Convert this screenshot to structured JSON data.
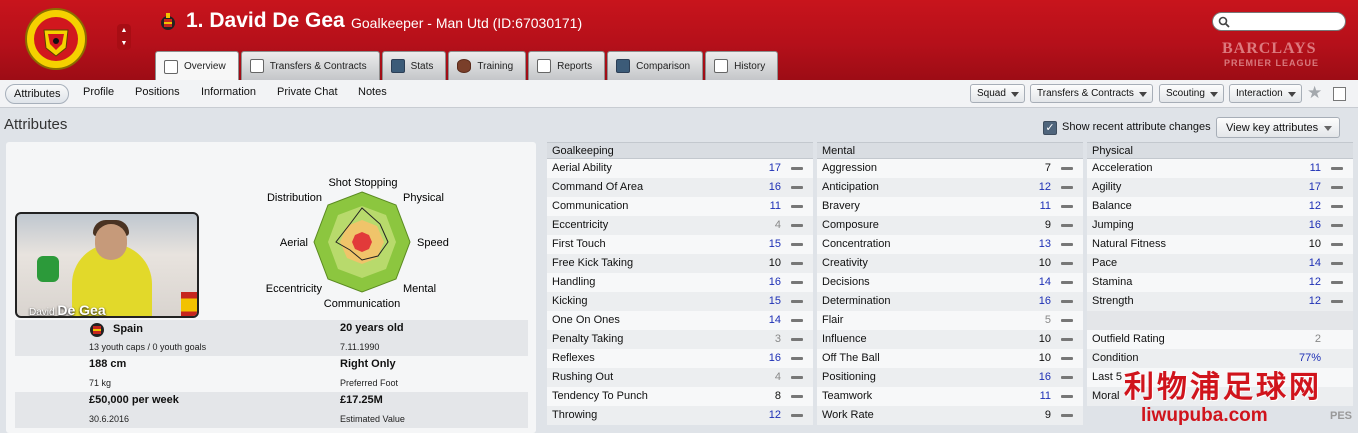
{
  "header": {
    "club_crest": "manchester-united-crest",
    "title": "1. David De Gea",
    "subtitle": "Goalkeeper - Man Utd (ID:67030171)",
    "sponsor_line1": "BARCLAYS",
    "sponsor_line2": "PREMIER LEAGUE"
  },
  "tabs": [
    {
      "label": "Overview",
      "icon": "overview-icon"
    },
    {
      "label": "Transfers & Contracts",
      "icon": "document-icon"
    },
    {
      "label": "Stats",
      "icon": "stats-icon"
    },
    {
      "label": "Training",
      "icon": "ball-icon"
    },
    {
      "label": "Reports",
      "icon": "report-icon"
    },
    {
      "label": "Comparison",
      "icon": "comparison-icon"
    },
    {
      "label": "History",
      "icon": "history-icon"
    }
  ],
  "subnav": {
    "items": [
      "Attributes",
      "Profile",
      "Positions",
      "Information",
      "Private Chat",
      "Notes"
    ],
    "dropdowns": [
      "Squad",
      "Transfers & Contracts",
      "Scouting",
      "Interaction"
    ]
  },
  "section": {
    "title": "Attributes",
    "show_recent_label": "Show recent attribute changes",
    "show_recent_checked": true,
    "view_key_label": "View key attributes"
  },
  "radar": {
    "labels": [
      "Shot Stopping",
      "Physical",
      "Speed",
      "Mental",
      "Communication",
      "Eccentricity",
      "Aerial",
      "Distribution"
    ]
  },
  "player": {
    "photo_caption_first": "David",
    "photo_caption_last": "De Gea",
    "nationality": "Spain",
    "caps": "13 youth caps / 0 youth goals",
    "age": "20 years old",
    "dob": "7.11.1990",
    "height": "188 cm",
    "weight": "71 kg",
    "foot": "Right Only",
    "foot_label": "Preferred Foot",
    "wage": "£50,000 per week",
    "contract_end": "30.6.2016",
    "value": "£17.25M",
    "value_label": "Estimated Value"
  },
  "goalkeeping": {
    "title": "Goalkeeping",
    "rows": [
      {
        "name": "Aerial Ability",
        "value": "17"
      },
      {
        "name": "Command Of Area",
        "value": "16"
      },
      {
        "name": "Communication",
        "value": "11"
      },
      {
        "name": "Eccentricity",
        "value": "4"
      },
      {
        "name": "First Touch",
        "value": "15"
      },
      {
        "name": "Free Kick Taking",
        "value": "10"
      },
      {
        "name": "Handling",
        "value": "16"
      },
      {
        "name": "Kicking",
        "value": "15"
      },
      {
        "name": "One On Ones",
        "value": "14"
      },
      {
        "name": "Penalty Taking",
        "value": "3"
      },
      {
        "name": "Reflexes",
        "value": "16"
      },
      {
        "name": "Rushing Out",
        "value": "4"
      },
      {
        "name": "Tendency To Punch",
        "value": "8"
      },
      {
        "name": "Throwing",
        "value": "12"
      }
    ]
  },
  "mental": {
    "title": "Mental",
    "rows": [
      {
        "name": "Aggression",
        "value": "7"
      },
      {
        "name": "Anticipation",
        "value": "12"
      },
      {
        "name": "Bravery",
        "value": "11"
      },
      {
        "name": "Composure",
        "value": "9"
      },
      {
        "name": "Concentration",
        "value": "13"
      },
      {
        "name": "Creativity",
        "value": "10"
      },
      {
        "name": "Decisions",
        "value": "14"
      },
      {
        "name": "Determination",
        "value": "16"
      },
      {
        "name": "Flair",
        "value": "5"
      },
      {
        "name": "Influence",
        "value": "10"
      },
      {
        "name": "Off The Ball",
        "value": "10"
      },
      {
        "name": "Positioning",
        "value": "16"
      },
      {
        "name": "Teamwork",
        "value": "11"
      },
      {
        "name": "Work Rate",
        "value": "9"
      }
    ]
  },
  "physical": {
    "title": "Physical",
    "rows": [
      {
        "name": "Acceleration",
        "value": "11"
      },
      {
        "name": "Agility",
        "value": "17"
      },
      {
        "name": "Balance",
        "value": "12"
      },
      {
        "name": "Jumping",
        "value": "16"
      },
      {
        "name": "Natural Fitness",
        "value": "10"
      },
      {
        "name": "Pace",
        "value": "14"
      },
      {
        "name": "Stamina",
        "value": "12"
      },
      {
        "name": "Strength",
        "value": "12"
      }
    ],
    "extra_rows": [
      {
        "name": "Outfield Rating",
        "value": "2"
      },
      {
        "name": "Condition",
        "value": "77%"
      },
      {
        "name": "Last 5",
        "value": ""
      },
      {
        "name": "Moral",
        "value": ""
      }
    ]
  },
  "watermark": {
    "line1": "利物浦足球网",
    "line2": "liwupuba.com",
    "line3": "PES"
  },
  "colors": {
    "header_red": "#b5101a",
    "high_value": "#1d2fb5",
    "radar_green": "#8cc63f",
    "radar_red": "#e23a3a"
  }
}
